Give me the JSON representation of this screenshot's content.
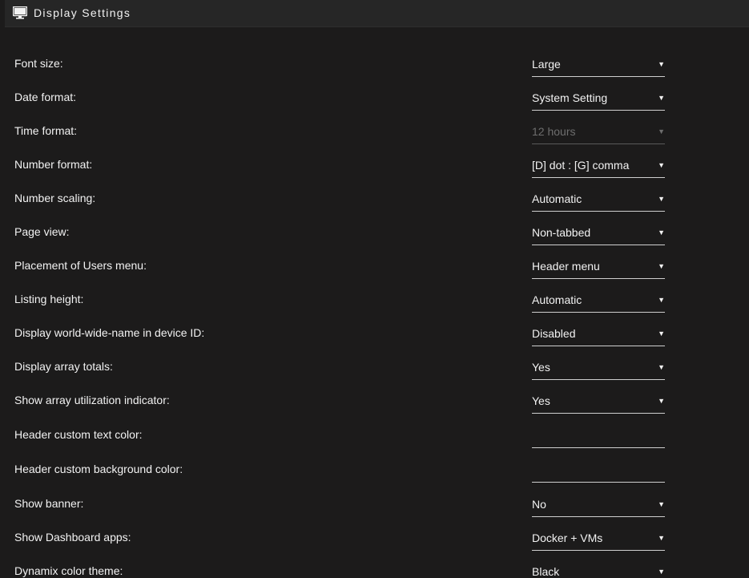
{
  "header": {
    "title": "Display Settings",
    "icon": "monitor-icon"
  },
  "settings": [
    {
      "label": "Font size:",
      "value": "Large",
      "type": "select"
    },
    {
      "label": "Date format:",
      "value": "System Setting",
      "type": "select"
    },
    {
      "label": "Time format:",
      "value": "12 hours",
      "type": "select",
      "disabled": true
    },
    {
      "label": "Number format:",
      "value": "[D] dot : [G] comma",
      "type": "select"
    },
    {
      "label": "Number scaling:",
      "value": "Automatic",
      "type": "select"
    },
    {
      "label": "Page view:",
      "value": "Non-tabbed",
      "type": "select"
    },
    {
      "label": "Placement of Users menu:",
      "value": "Header menu",
      "type": "select"
    },
    {
      "label": "Listing height:",
      "value": "Automatic",
      "type": "select"
    },
    {
      "label": "Display world-wide-name in device ID:",
      "value": "Disabled",
      "type": "select"
    },
    {
      "label": "Display array totals:",
      "value": "Yes",
      "type": "select"
    },
    {
      "label": "Show array utilization indicator:",
      "value": "Yes",
      "type": "select"
    },
    {
      "label": "Header custom text color:",
      "value": "",
      "type": "input"
    },
    {
      "label": "Header custom background color:",
      "value": "",
      "type": "input"
    },
    {
      "label": "Show banner:",
      "value": "No",
      "type": "select"
    },
    {
      "label": "Show Dashboard apps:",
      "value": "Docker + VMs",
      "type": "select"
    },
    {
      "label": "Dynamix color theme:",
      "value": "Black",
      "type": "select"
    }
  ],
  "colors": {
    "background": "#1c1b1b",
    "title_bar": "#262626",
    "text": "#f2f2f2",
    "disabled_text": "#6e6e6e"
  }
}
